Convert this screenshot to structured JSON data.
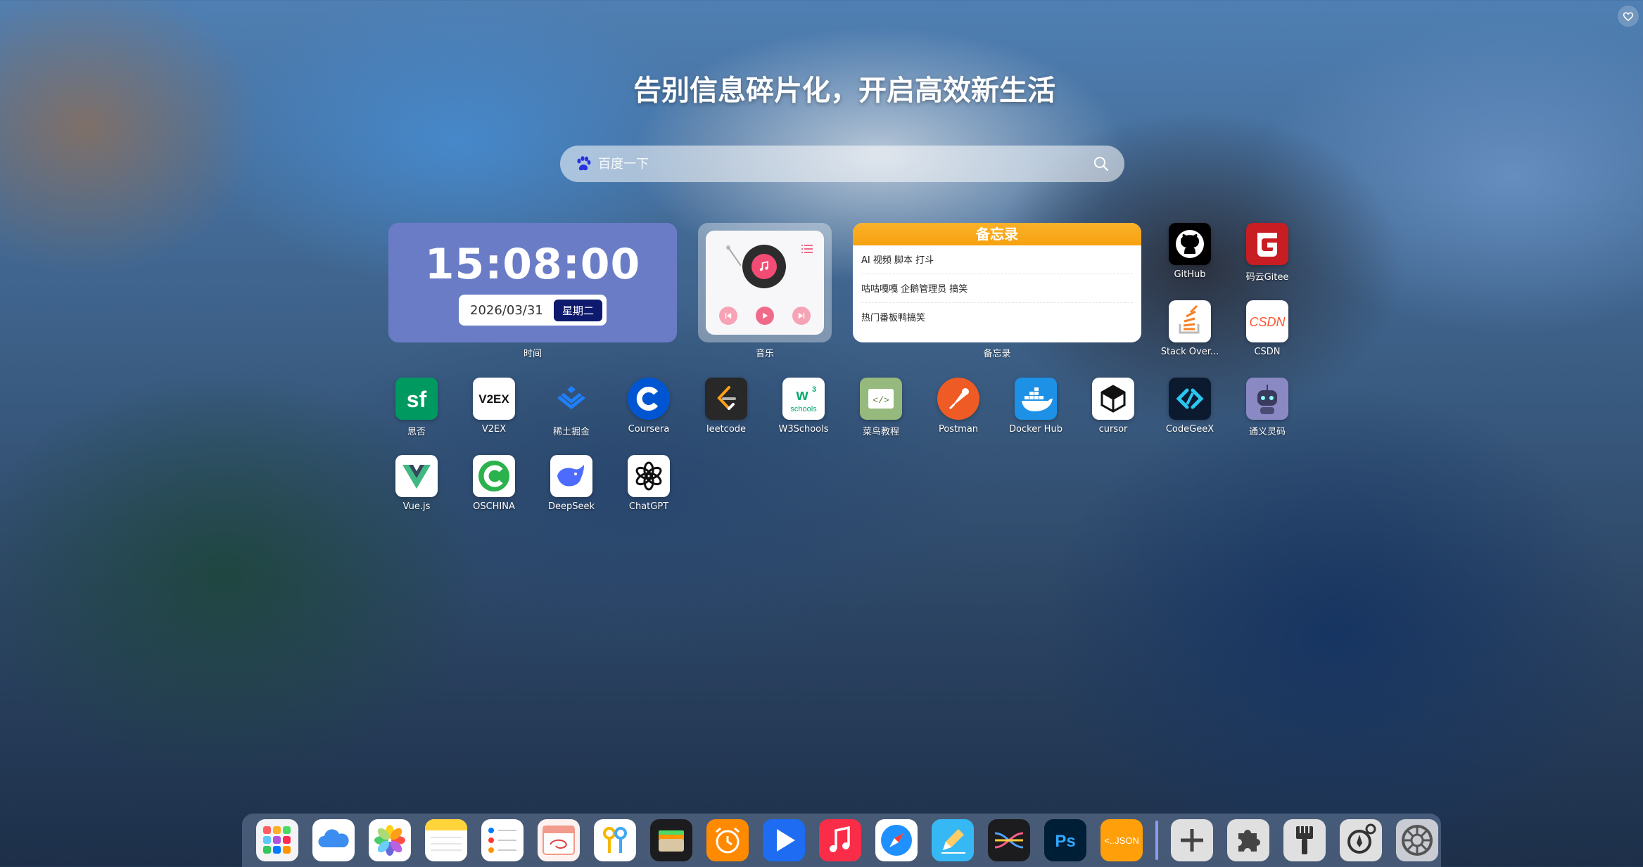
{
  "header": {
    "slogan": "告别信息碎片化，开启高效新生活"
  },
  "search": {
    "placeholder": "百度一下"
  },
  "widgets": {
    "clock": {
      "time": "15:08:00",
      "date": "2026/03/31",
      "weekday": "星期二",
      "caption": "时间"
    },
    "music": {
      "caption": "音乐"
    },
    "memo": {
      "title": "备忘录",
      "caption": "备忘录",
      "items": [
        "AI 视频 脚本 打斗",
        "咕咕嘎嘎 企鹅管理员 搞笑",
        "热门番板鸭搞笑"
      ]
    }
  },
  "apps": [
    {
      "label": "GitHub",
      "icon": "github-icon"
    },
    {
      "label": "码云Gitee",
      "icon": "gitee-icon"
    },
    {
      "label": "Stack Over...",
      "icon": "stackoverflow-icon"
    },
    {
      "label": "CSDN",
      "icon": "csdn-icon"
    },
    {
      "label": "思否",
      "icon": "segmentfault-icon"
    },
    {
      "label": "V2EX",
      "icon": "v2ex-icon"
    },
    {
      "label": "稀土掘金",
      "icon": "juejin-icon"
    },
    {
      "label": "Coursera",
      "icon": "coursera-icon"
    },
    {
      "label": "leetcode",
      "icon": "leetcode-icon"
    },
    {
      "label": "W3Schools",
      "icon": "w3schools-icon"
    },
    {
      "label": "菜鸟教程",
      "icon": "runoob-icon"
    },
    {
      "label": "Postman",
      "icon": "postman-icon"
    },
    {
      "label": "Docker Hub",
      "icon": "docker-icon"
    },
    {
      "label": "cursor",
      "icon": "cursor-icon"
    },
    {
      "label": "CodeGeeX",
      "icon": "codegeex-icon"
    },
    {
      "label": "通义灵码",
      "icon": "tongyi-icon"
    },
    {
      "label": "Vue.js",
      "icon": "vue-icon"
    },
    {
      "label": "OSCHINA",
      "icon": "oschina-icon"
    },
    {
      "label": "DeepSeek",
      "icon": "deepseek-icon"
    },
    {
      "label": "ChatGPT",
      "icon": "chatgpt-icon"
    }
  ],
  "tile_text": {
    "v2ex": "V2EX",
    "w3": "schools",
    "csdn": "CSDN",
    "json": "<..JSON",
    "ps": "Ps"
  },
  "dock": [
    "launchpad-icon",
    "icloud-icon",
    "photos-icon",
    "notes-icon",
    "reminders-icon",
    "calendar-icon",
    "keys-icon",
    "wallet-icon",
    "alarm-icon",
    "play-icon",
    "music-icon",
    "safari-icon",
    "pencil-icon",
    "split-icon",
    "photoshop-icon",
    "json-icon",
    "plus-icon",
    "puzzle-icon",
    "brush-icon",
    "compass-gear-icon",
    "settings-icon"
  ],
  "colors": {
    "clock_bg": "#6b7cc7",
    "memo_header": "#f6a20f",
    "weekday_bg": "#0e1a6e"
  }
}
